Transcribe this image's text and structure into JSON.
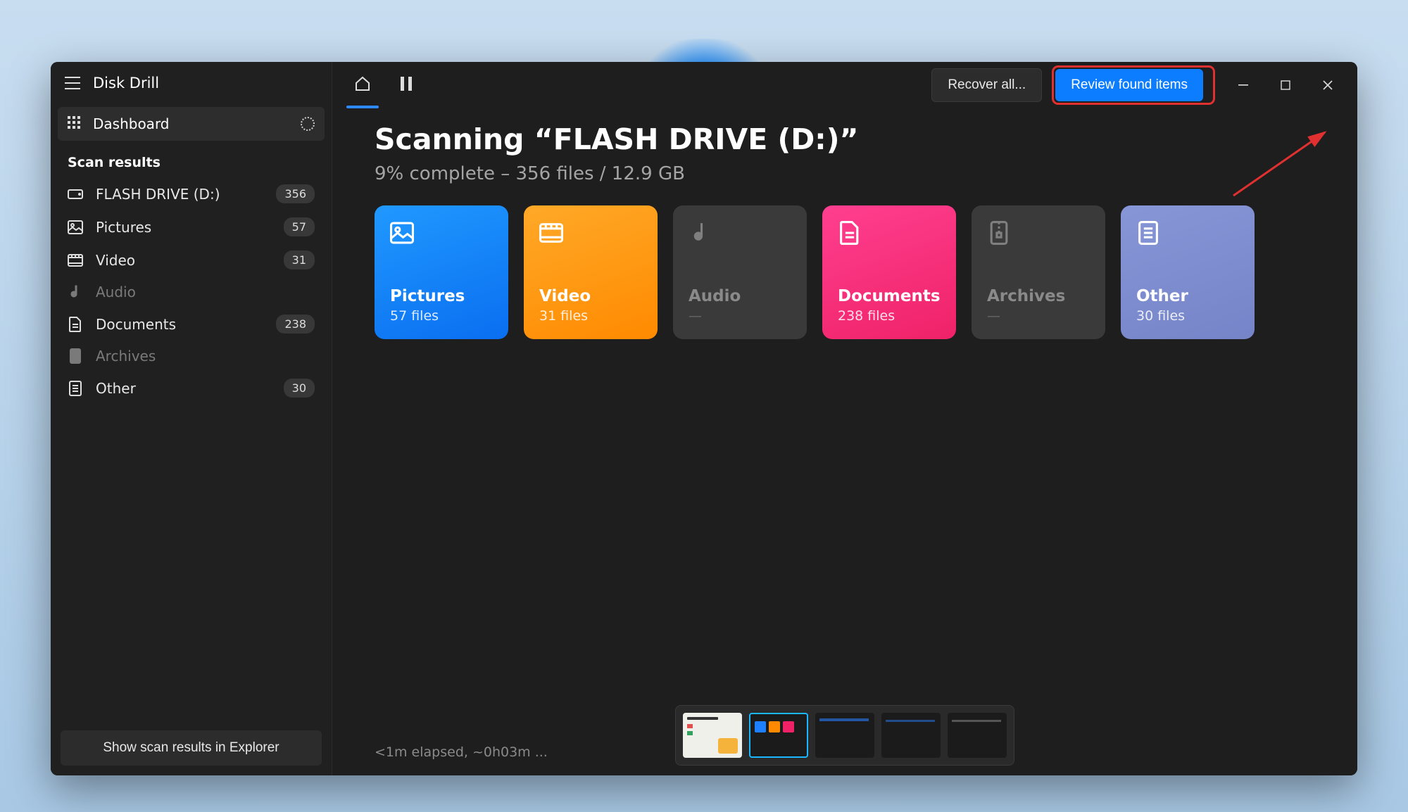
{
  "app": {
    "title": "Disk Drill"
  },
  "sidebar": {
    "dashboard_label": "Dashboard",
    "section_heading": "Scan results",
    "items": [
      {
        "label": "FLASH DRIVE (D:)",
        "count": "356",
        "icon": "drive",
        "muted": false
      },
      {
        "label": "Pictures",
        "count": "57",
        "icon": "picture",
        "muted": false
      },
      {
        "label": "Video",
        "count": "31",
        "icon": "video",
        "muted": false
      },
      {
        "label": "Audio",
        "count": "",
        "icon": "audio",
        "muted": true
      },
      {
        "label": "Documents",
        "count": "238",
        "icon": "document",
        "muted": false
      },
      {
        "label": "Archives",
        "count": "",
        "icon": "archive",
        "muted": true
      },
      {
        "label": "Other",
        "count": "30",
        "icon": "other",
        "muted": false
      }
    ],
    "explorer_button": "Show scan results in Explorer"
  },
  "topbar": {
    "recover_all": "Recover all...",
    "review_found": "Review found items"
  },
  "scan": {
    "title": "Scanning “FLASH DRIVE (D:)”",
    "subtitle": "9% complete – 356 files / 12.9 GB"
  },
  "cards": [
    {
      "title": "Pictures",
      "sub": "57 files",
      "type": "pictures",
      "icon": "picture"
    },
    {
      "title": "Video",
      "sub": "31 files",
      "type": "video",
      "icon": "video"
    },
    {
      "title": "Audio",
      "sub": "—",
      "type": "empty",
      "icon": "audio"
    },
    {
      "title": "Documents",
      "sub": "238 files",
      "type": "documents",
      "icon": "document"
    },
    {
      "title": "Archives",
      "sub": "—",
      "type": "empty",
      "icon": "archive"
    },
    {
      "title": "Other",
      "sub": "30 files",
      "type": "other",
      "icon": "other"
    }
  ],
  "footer": {
    "status": "<1m elapsed, ~0h03m ..."
  }
}
